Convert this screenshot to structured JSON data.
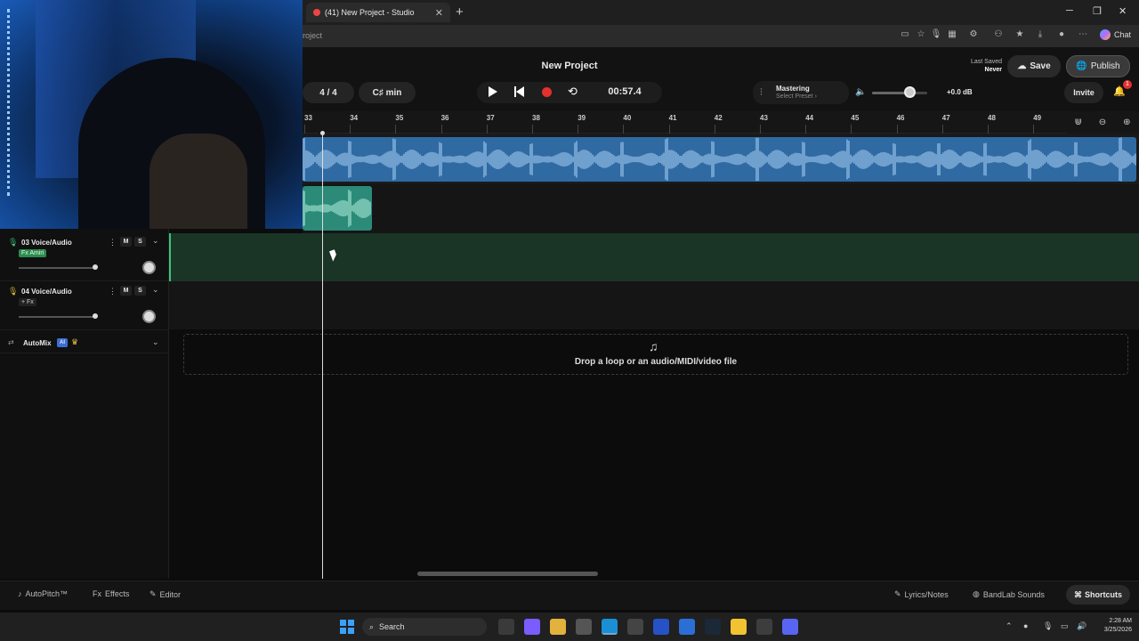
{
  "browser": {
    "tab_title": "(41) New Project - Studio",
    "tab_close": "✕",
    "new_tab": "+",
    "address_partial": "roject",
    "chat_label": "Chat",
    "win_min": "─",
    "win_max": "❐",
    "win_close": "✕"
  },
  "header": {
    "project_title": "New Project",
    "last_saved_label": "Last Saved",
    "last_saved_value": "Never",
    "save_label": "Save",
    "publish_label": "Publish",
    "time_signature": "4 / 4",
    "key": "C♯ min",
    "time_display": "00:57.4",
    "mastering_label": "Mastering",
    "mastering_preset": "Select Preset ›",
    "volume_db": "+0.0 dB",
    "volume_level": 0.7,
    "invite_label": "Invite",
    "notification_count": "1"
  },
  "ruler": {
    "bars": [
      "33",
      "34",
      "35",
      "36",
      "37",
      "38",
      "39",
      "40",
      "41",
      "42",
      "43",
      "44",
      "45",
      "46",
      "47",
      "48",
      "49"
    ]
  },
  "tracks": [
    {
      "name": "03 Voice/Audio",
      "fx_label": "Fx Amiri",
      "mute": "M",
      "solo": "S",
      "menu": "⋮",
      "chevron": "⌄",
      "volume": 0.9
    },
    {
      "name": "04 Voice/Audio",
      "fx_label": "+ Fx",
      "mute": "M",
      "solo": "S",
      "menu": "⋮",
      "chevron": "⌄",
      "volume": 0.9
    }
  ],
  "automix": {
    "label": "AutoMix",
    "ai_badge": "AI",
    "chevron": "⌄"
  },
  "dropzone": {
    "text": "Drop a loop or an audio/MIDI/video file"
  },
  "bottombar": {
    "autopitch": "AutoPitch™",
    "effects_prefix": "Fx",
    "effects": "Effects",
    "editor": "Editor",
    "lyrics": "Lyrics/Notes",
    "bandlab_sounds": "BandLab Sounds",
    "shortcuts": "Shortcuts"
  },
  "taskbar": {
    "search_placeholder": "Search",
    "time": "2:28 AM",
    "date": "3/25/2026"
  },
  "colors": {
    "track1_clip": "#2f6aa3",
    "track2_clip": "#2b8a78",
    "record": "#e53030",
    "active_track_lane": "#1a3526"
  }
}
